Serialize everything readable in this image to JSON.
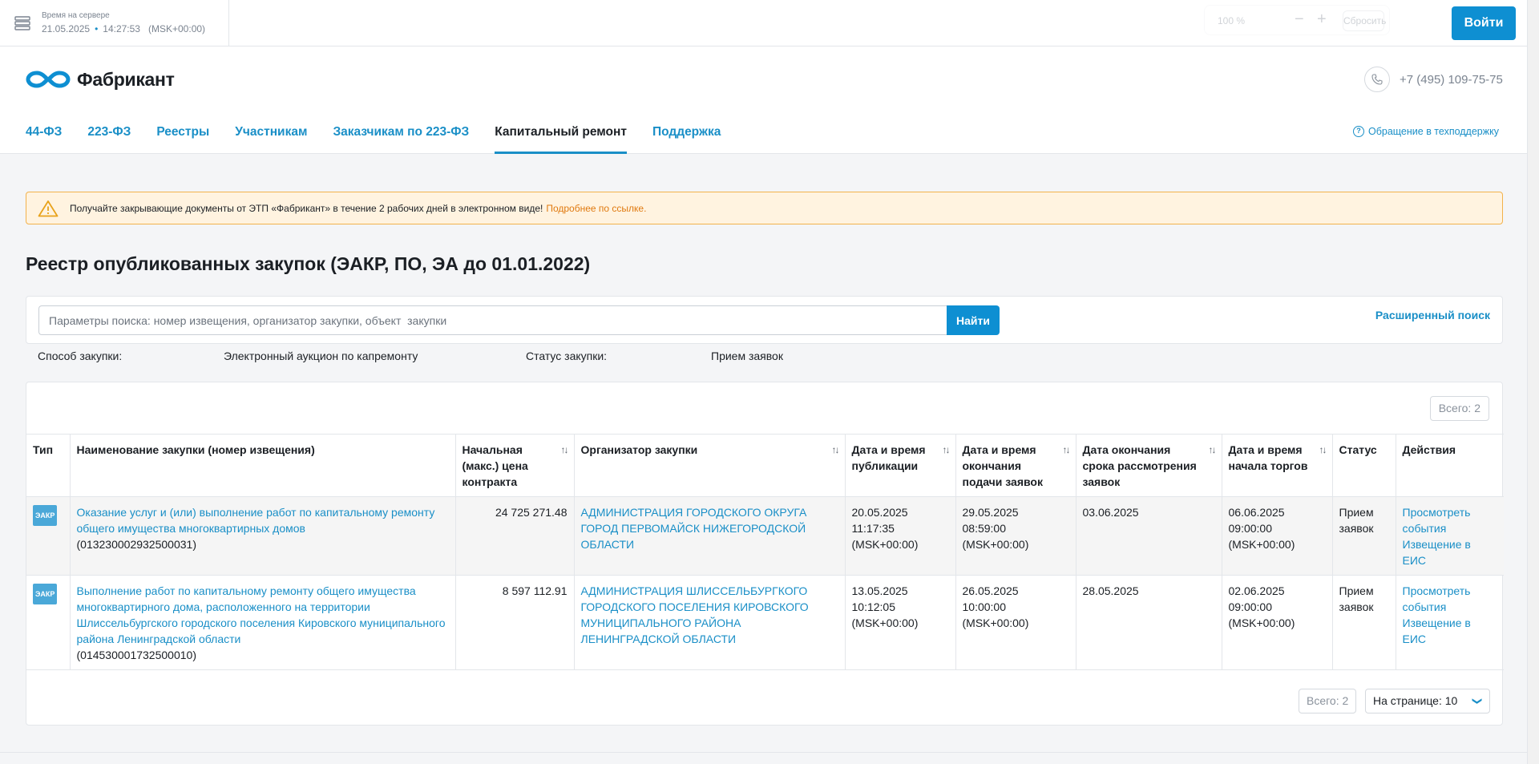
{
  "server": {
    "label": "Время на сервере",
    "date": "21.05.2025",
    "time": "14:27:53",
    "tz": "(MSK+00:00)"
  },
  "zoom": {
    "value": "100 %",
    "minus": "−",
    "plus": "+",
    "reset": "Сбросить"
  },
  "login_label": "Войти",
  "logo_text": "Фабрикант",
  "phone": "+7 (495) 109-75-75",
  "nav": {
    "items": [
      {
        "label": "44-ФЗ"
      },
      {
        "label": "223-ФЗ"
      },
      {
        "label": "Реестры"
      },
      {
        "label": "Участникам"
      },
      {
        "label": "Заказчикам по 223-ФЗ"
      },
      {
        "label": "Капитальный ремонт"
      },
      {
        "label": "Поддержка"
      }
    ],
    "active_index": 5,
    "support_link": "Обращение в техподдержку"
  },
  "notice": {
    "text": "Получайте закрывающие документы от ЭТП «Фабрикант» в течение 2 рабочих дней в электронном виде!",
    "link": "Подробнее по ссылке."
  },
  "page_title": "Реестр опубликованных закупок (ЭАКР, ПО, ЭА до 01.01.2022)",
  "search": {
    "placeholder": "Параметры поиска: номер извещения, организатор закупки, объект  закупки",
    "button": "Найти",
    "advanced": "Расширенный поиск"
  },
  "filters": {
    "method_label": "Способ закупки:",
    "method_value": "Электронный аукцион по капремонту",
    "status_label": "Статус закупки:",
    "status_value": "Прием заявок"
  },
  "total_label": "Всего: 2",
  "table": {
    "headers": {
      "type": "Тип",
      "name": "Наименование закупки (номер извещения)",
      "price": "Начальная (макс.) цена контракта",
      "org": "Организатор закупки",
      "pub": "Дата и время публикации",
      "end": "Дата и время окончания подачи заявок",
      "review": "Дата окончания срока рассмотрения заявок",
      "start": "Дата и время начала торгов",
      "status": "Статус",
      "actions": "Действия"
    },
    "sort_glyph": "↑↓",
    "rows": [
      {
        "type": "ЭАКР",
        "name": "Оказание услуг и (или) выполнение работ по капитальному ремонту общего имущества многоквартирных домов",
        "number": "(013230002932500031)",
        "price": "24 725 271.48",
        "org": "АДМИНИСТРАЦИЯ ГОРОДСКОГО ОКРУГА ГОРОД ПЕРВОМАЙСК НИЖЕГОРОДСКОЙ ОБЛАСТИ",
        "pub_date": "20.05.2025",
        "pub_time": "11:17:35",
        "pub_tz": "(MSK+00:00)",
        "end_date": "29.05.2025",
        "end_time": "08:59:00",
        "end_tz": "(MSK+00:00)",
        "review": "03.06.2025",
        "start_date": "06.06.2025",
        "start_time": "09:00:00",
        "start_tz": "(MSK+00:00)",
        "status": "Прием заявок",
        "action_view": "Просмотреть события",
        "action_eis": "Извещение в ЕИС"
      },
      {
        "type": "ЭАКР",
        "name": "Выполнение работ по капитальному ремонту общего имущества многоквартирного дома, расположенного на территории Шлиссельбургского городского поселения Кировского муниципального района Ленинградской области",
        "number": "(014530001732500010)",
        "price": "8 597 112.91",
        "org": "АДМИНИСТРАЦИЯ ШЛИССЕЛЬБУРГКОГО ГОРОДСКОГО ПОСЕЛЕНИЯ КИРОВСКОГО МУНИЦИПАЛЬНОГО РАЙОНА ЛЕНИНГРАДСКОЙ ОБЛАСТИ",
        "pub_date": "13.05.2025",
        "pub_time": "10:12:05",
        "pub_tz": "(MSK+00:00)",
        "end_date": "26.05.2025",
        "end_time": "10:00:00",
        "end_tz": "(MSK+00:00)",
        "review": "28.05.2025",
        "start_date": "02.06.2025",
        "start_time": "09:00:00",
        "start_tz": "(MSK+00:00)",
        "status": "Прием заявок",
        "action_view": "Просмотреть события",
        "action_eis": "Извещение в ЕИС"
      }
    ]
  },
  "per_page": {
    "label": "На странице: 10"
  },
  "colors": {
    "accent": "#0e8fd2",
    "link": "#1a8fc7",
    "notice_bg": "#fff3e0",
    "notice_border": "#f2b24c"
  }
}
